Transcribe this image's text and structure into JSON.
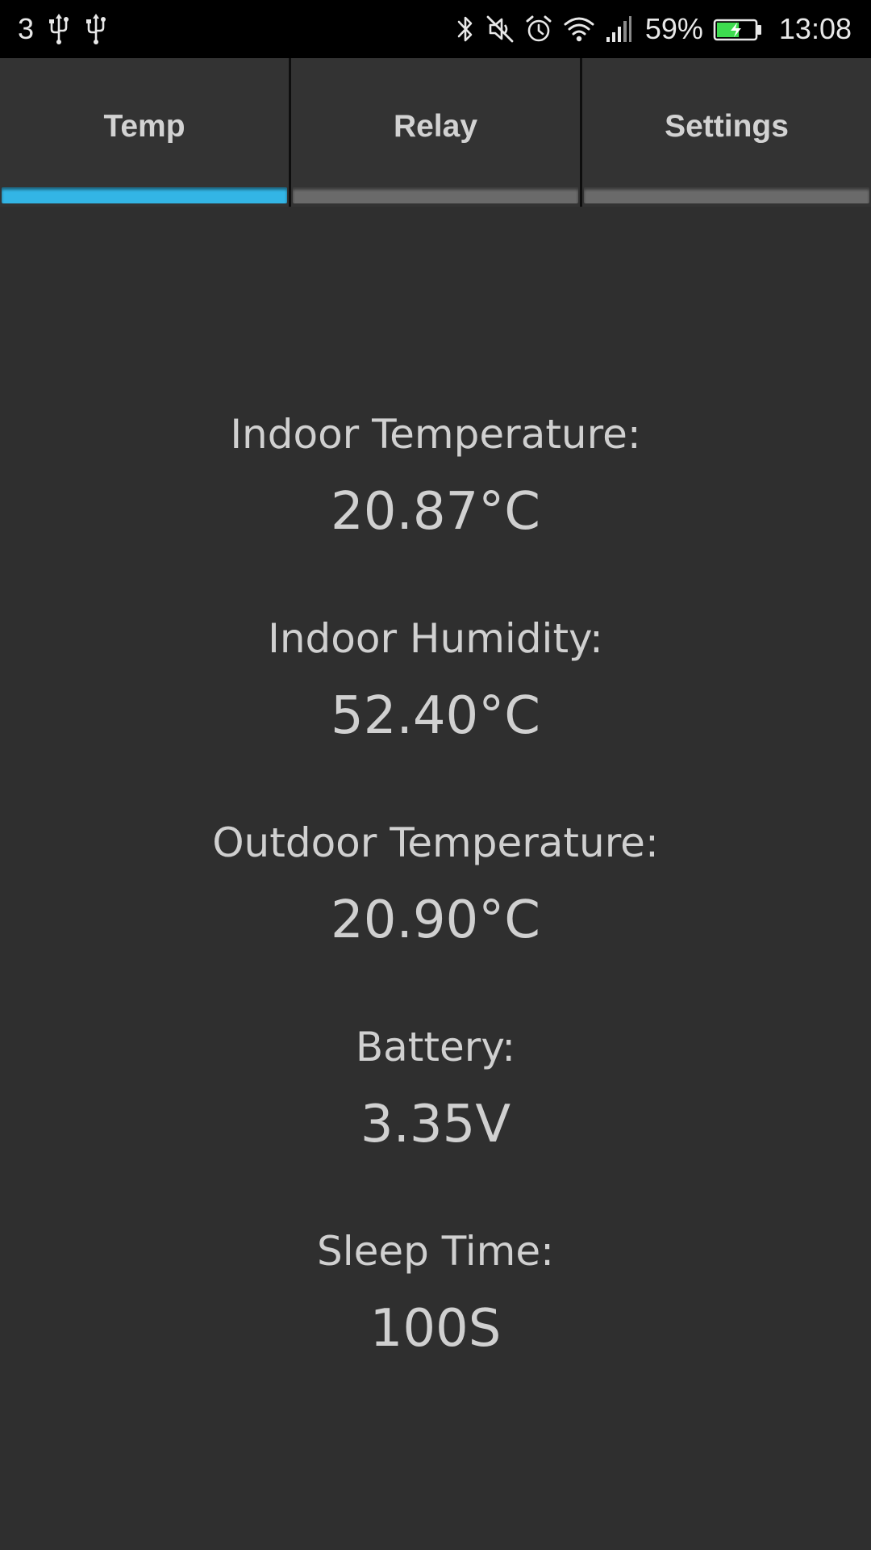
{
  "status_bar": {
    "notification_count": "3",
    "left_icons": [
      "usb-icon",
      "usb-icon"
    ],
    "right_icons": [
      "bluetooth-icon",
      "mute-icon",
      "alarm-icon",
      "wifi-icon",
      "cell-signal-icon"
    ],
    "battery_percent": "59%",
    "battery_icon": "battery-charging-icon",
    "battery_level": 0.59,
    "time": "13:08"
  },
  "tabs": [
    {
      "label": "Temp",
      "active": true
    },
    {
      "label": "Relay",
      "active": false
    },
    {
      "label": "Settings",
      "active": false
    }
  ],
  "readings": [
    {
      "label": "Indoor Temperature:",
      "value": "20.87°C"
    },
    {
      "label": "Indoor Humidity:",
      "value": "52.40°C"
    },
    {
      "label": "Outdoor Temperature:",
      "value": "20.90°C"
    },
    {
      "label": "Battery:",
      "value": "3.35V"
    },
    {
      "label": "Sleep Time:",
      "value": "100S"
    }
  ],
  "colors": {
    "background": "#2f2f2f",
    "status_bar": "#000000",
    "tab_bar": "#333333",
    "accent": "#33b5e5",
    "inactive_indicator": "#6a6a6a",
    "text": "#d0d0d0",
    "battery_fill": "#3ddc4f"
  }
}
